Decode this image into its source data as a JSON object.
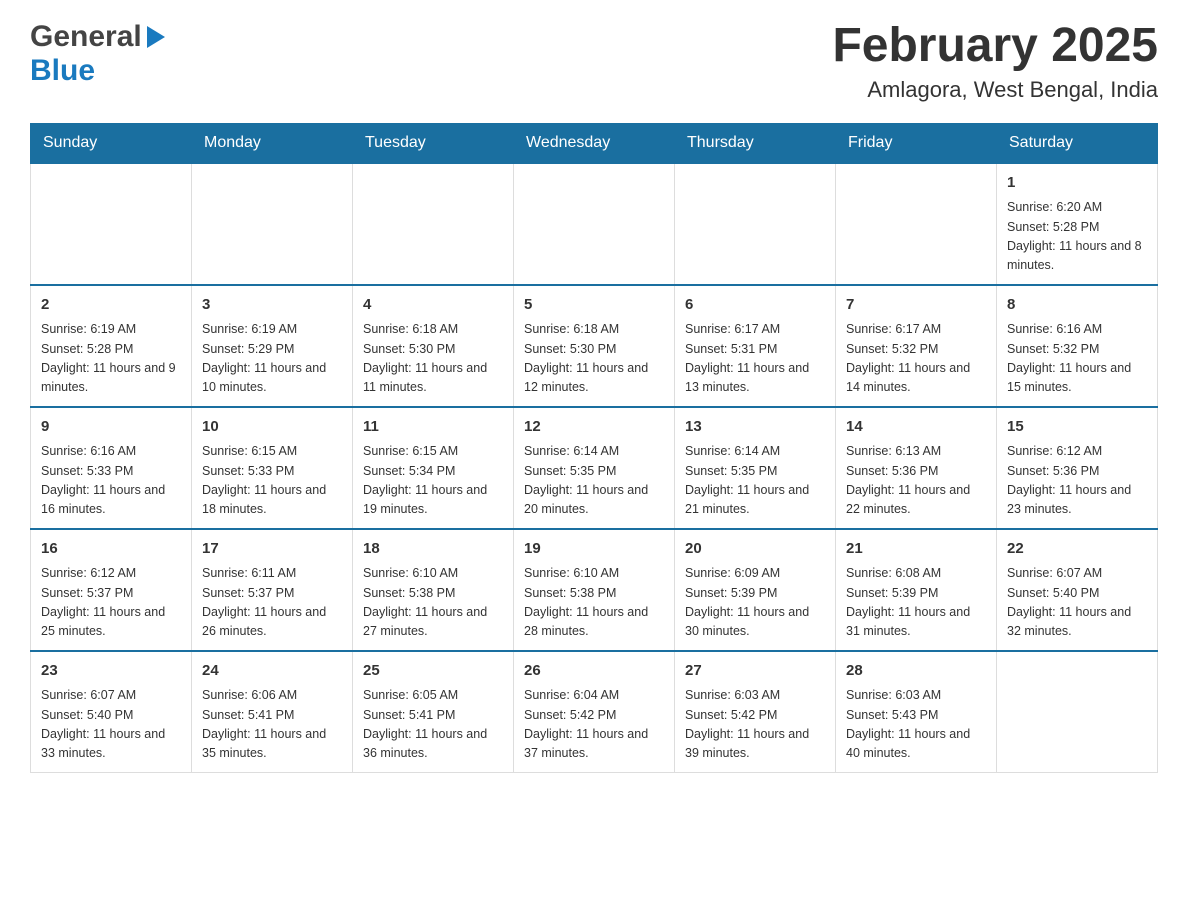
{
  "header": {
    "logo": {
      "general": "General",
      "blue": "Blue"
    },
    "title": "February 2025",
    "location": "Amlagora, West Bengal, India"
  },
  "weekdays": [
    "Sunday",
    "Monday",
    "Tuesday",
    "Wednesday",
    "Thursday",
    "Friday",
    "Saturday"
  ],
  "weeks": [
    {
      "days": [
        {
          "date": "",
          "info": ""
        },
        {
          "date": "",
          "info": ""
        },
        {
          "date": "",
          "info": ""
        },
        {
          "date": "",
          "info": ""
        },
        {
          "date": "",
          "info": ""
        },
        {
          "date": "",
          "info": ""
        },
        {
          "date": "1",
          "info": "Sunrise: 6:20 AM\nSunset: 5:28 PM\nDaylight: 11 hours and 8 minutes."
        }
      ]
    },
    {
      "days": [
        {
          "date": "2",
          "info": "Sunrise: 6:19 AM\nSunset: 5:28 PM\nDaylight: 11 hours and 9 minutes."
        },
        {
          "date": "3",
          "info": "Sunrise: 6:19 AM\nSunset: 5:29 PM\nDaylight: 11 hours and 10 minutes."
        },
        {
          "date": "4",
          "info": "Sunrise: 6:18 AM\nSunset: 5:30 PM\nDaylight: 11 hours and 11 minutes."
        },
        {
          "date": "5",
          "info": "Sunrise: 6:18 AM\nSunset: 5:30 PM\nDaylight: 11 hours and 12 minutes."
        },
        {
          "date": "6",
          "info": "Sunrise: 6:17 AM\nSunset: 5:31 PM\nDaylight: 11 hours and 13 minutes."
        },
        {
          "date": "7",
          "info": "Sunrise: 6:17 AM\nSunset: 5:32 PM\nDaylight: 11 hours and 14 minutes."
        },
        {
          "date": "8",
          "info": "Sunrise: 6:16 AM\nSunset: 5:32 PM\nDaylight: 11 hours and 15 minutes."
        }
      ]
    },
    {
      "days": [
        {
          "date": "9",
          "info": "Sunrise: 6:16 AM\nSunset: 5:33 PM\nDaylight: 11 hours and 16 minutes."
        },
        {
          "date": "10",
          "info": "Sunrise: 6:15 AM\nSunset: 5:33 PM\nDaylight: 11 hours and 18 minutes."
        },
        {
          "date": "11",
          "info": "Sunrise: 6:15 AM\nSunset: 5:34 PM\nDaylight: 11 hours and 19 minutes."
        },
        {
          "date": "12",
          "info": "Sunrise: 6:14 AM\nSunset: 5:35 PM\nDaylight: 11 hours and 20 minutes."
        },
        {
          "date": "13",
          "info": "Sunrise: 6:14 AM\nSunset: 5:35 PM\nDaylight: 11 hours and 21 minutes."
        },
        {
          "date": "14",
          "info": "Sunrise: 6:13 AM\nSunset: 5:36 PM\nDaylight: 11 hours and 22 minutes."
        },
        {
          "date": "15",
          "info": "Sunrise: 6:12 AM\nSunset: 5:36 PM\nDaylight: 11 hours and 23 minutes."
        }
      ]
    },
    {
      "days": [
        {
          "date": "16",
          "info": "Sunrise: 6:12 AM\nSunset: 5:37 PM\nDaylight: 11 hours and 25 minutes."
        },
        {
          "date": "17",
          "info": "Sunrise: 6:11 AM\nSunset: 5:37 PM\nDaylight: 11 hours and 26 minutes."
        },
        {
          "date": "18",
          "info": "Sunrise: 6:10 AM\nSunset: 5:38 PM\nDaylight: 11 hours and 27 minutes."
        },
        {
          "date": "19",
          "info": "Sunrise: 6:10 AM\nSunset: 5:38 PM\nDaylight: 11 hours and 28 minutes."
        },
        {
          "date": "20",
          "info": "Sunrise: 6:09 AM\nSunset: 5:39 PM\nDaylight: 11 hours and 30 minutes."
        },
        {
          "date": "21",
          "info": "Sunrise: 6:08 AM\nSunset: 5:39 PM\nDaylight: 11 hours and 31 minutes."
        },
        {
          "date": "22",
          "info": "Sunrise: 6:07 AM\nSunset: 5:40 PM\nDaylight: 11 hours and 32 minutes."
        }
      ]
    },
    {
      "days": [
        {
          "date": "23",
          "info": "Sunrise: 6:07 AM\nSunset: 5:40 PM\nDaylight: 11 hours and 33 minutes."
        },
        {
          "date": "24",
          "info": "Sunrise: 6:06 AM\nSunset: 5:41 PM\nDaylight: 11 hours and 35 minutes."
        },
        {
          "date": "25",
          "info": "Sunrise: 6:05 AM\nSunset: 5:41 PM\nDaylight: 11 hours and 36 minutes."
        },
        {
          "date": "26",
          "info": "Sunrise: 6:04 AM\nSunset: 5:42 PM\nDaylight: 11 hours and 37 minutes."
        },
        {
          "date": "27",
          "info": "Sunrise: 6:03 AM\nSunset: 5:42 PM\nDaylight: 11 hours and 39 minutes."
        },
        {
          "date": "28",
          "info": "Sunrise: 6:03 AM\nSunset: 5:43 PM\nDaylight: 11 hours and 40 minutes."
        },
        {
          "date": "",
          "info": ""
        }
      ]
    }
  ]
}
